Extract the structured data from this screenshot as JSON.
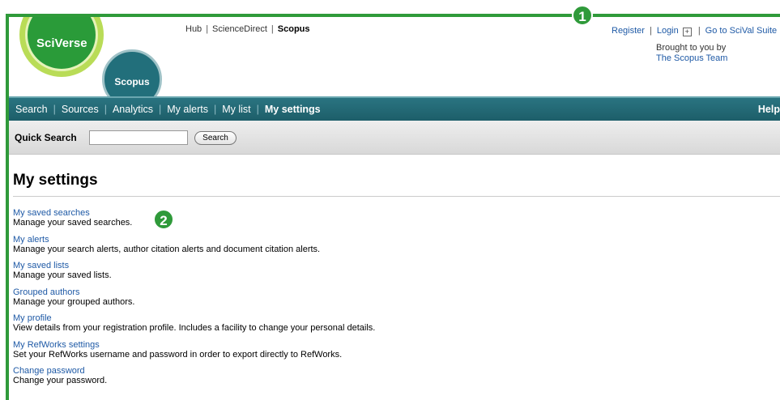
{
  "brand": {
    "sciverse": "SciVerse",
    "scopus": "Scopus"
  },
  "hub_links": [
    "Hub",
    "ScienceDirect",
    "Scopus"
  ],
  "account": {
    "register": "Register",
    "login": "Login",
    "plus": "+",
    "scival": "Go to SciVal Suite"
  },
  "brought_by": {
    "line": "Brought to you by",
    "team": "The Scopus Team"
  },
  "markers": [
    "1",
    "2"
  ],
  "nav": {
    "items": [
      "Search",
      "Sources",
      "Analytics",
      "My alerts",
      "My list",
      "My settings"
    ],
    "help": "Help"
  },
  "quick_search": {
    "label": "Quick Search",
    "value": "",
    "button": "Search"
  },
  "page_title": "My settings",
  "settings": [
    {
      "link": "My saved searches",
      "desc": "Manage your saved searches."
    },
    {
      "link": "My alerts",
      "desc": "Manage your search alerts, author citation alerts and document citation alerts."
    },
    {
      "link": "My saved lists",
      "desc": "Manage your saved lists."
    },
    {
      "link": "Grouped authors",
      "desc": "Manage your grouped authors."
    },
    {
      "link": "My profile",
      "desc": "View details from your registration profile. Includes a facility to change your personal details."
    },
    {
      "link": "My RefWorks settings",
      "desc": "Set your RefWorks username and password in order to export directly to RefWorks."
    },
    {
      "link": "Change password",
      "desc": "Change your password."
    }
  ],
  "colors": {
    "annotation": "#2f9a3a",
    "nav": "#226f7b",
    "link": "#1f5aa6"
  }
}
